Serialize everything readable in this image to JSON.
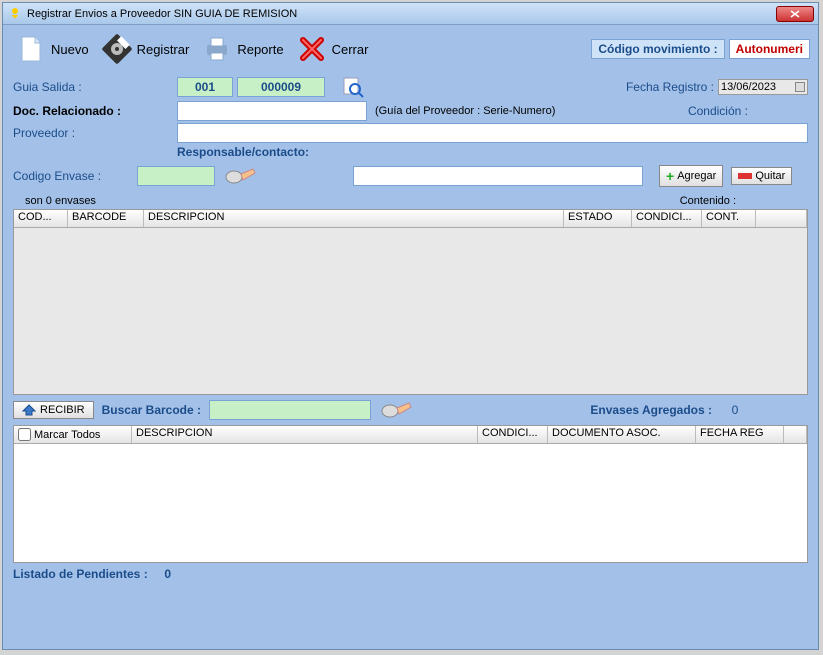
{
  "window": {
    "title": "Registrar Envios a Proveedor SIN GUIA DE REMISION"
  },
  "toolbar": {
    "nuevo": "Nuevo",
    "registrar": "Registrar",
    "reporte": "Reporte",
    "cerrar": "Cerrar",
    "codmov_label": "Código movimiento :",
    "autonum": "Autonumeri"
  },
  "form": {
    "guia_salida_label": "Guia Salida :",
    "serie": "001",
    "numero": "000009",
    "fecha_label": "Fecha Registro :",
    "fecha_value": "13/06/2023",
    "doc_rel_label": "Doc. Relacionado :",
    "doc_rel_hint": "(Guía del Proveedor : Serie-Numero)",
    "condicion_label": "Condición :",
    "proveedor_label": "Proveedor :",
    "responsable_label": "Responsable/contacto:",
    "cod_envase_label": "Codigo Envase :",
    "agregar": "Agregar",
    "quitar": "Quitar"
  },
  "grid1": {
    "count_text": "son 0 envases",
    "contenido_label": "Contenido :",
    "cols": {
      "cod": "COD...",
      "barcode": "BARCODE",
      "descripcion": "DESCRIPCION",
      "estado": "ESTADO",
      "condici": "CONDICI...",
      "cont": "CONT."
    }
  },
  "receive": {
    "btn": "RECIBIR",
    "buscar_label": "Buscar Barcode :",
    "agregados_label": "Envases Agregados :",
    "agregados_val": "0"
  },
  "grid2": {
    "marcar": "Marcar Todos",
    "cols": {
      "desc": "DESCRIPCION",
      "cond": "CONDICI...",
      "doc": "DOCUMENTO ASOC.",
      "fecha": "FECHA REG"
    }
  },
  "footer": {
    "pendientes_label": "Listado de Pendientes :",
    "pendientes_val": "0"
  }
}
